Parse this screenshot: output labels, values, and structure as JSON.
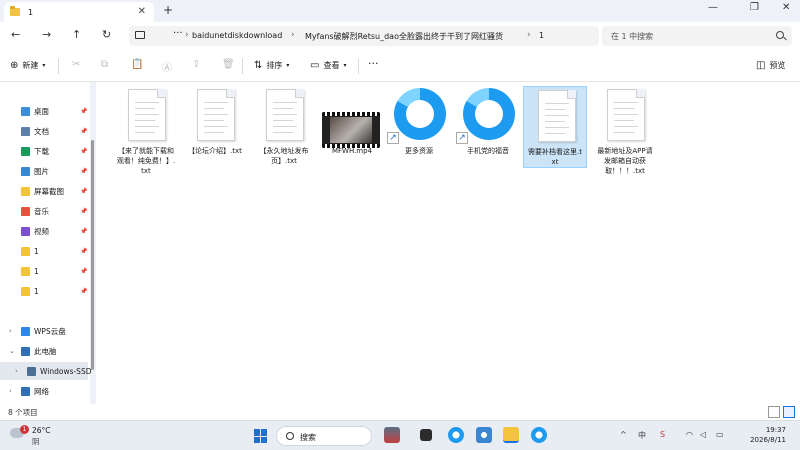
{
  "window": {
    "tab_title": "1",
    "tab_close": "✕",
    "new_tab": "+",
    "minimize": "—",
    "maximize": "❐",
    "close": "✕"
  },
  "nav": {
    "back": "←",
    "forward": "→",
    "up": "↑",
    "refresh": "↻",
    "more": "···",
    "breadcrumbs": [
      "baidunetdiskdownload",
      "Myfans破解烈Retsu_dao全脸露出终于干到了网红骚货",
      "1"
    ],
    "separator": "›",
    "search_placeholder": "在 1 中搜索"
  },
  "toolbar": {
    "new_label": "新建",
    "sort_label": "排序",
    "view_label": "查看",
    "more_label": "···",
    "preview_label": "预览"
  },
  "sidebar": {
    "quick": [
      {
        "label": "桌面",
        "icon": "desktop-icon",
        "color": "#3b8fd9"
      },
      {
        "label": "文档",
        "icon": "documents-icon",
        "color": "#5b7fa6"
      },
      {
        "label": "下载",
        "icon": "download-icon",
        "color": "#1a9b5e"
      },
      {
        "label": "图片",
        "icon": "pictures-icon",
        "color": "#3a86d0"
      },
      {
        "label": "屏幕截图",
        "icon": "folder-icon",
        "color": "#f3c33e"
      },
      {
        "label": "音乐",
        "icon": "music-icon",
        "color": "#e0553b"
      },
      {
        "label": "视频",
        "icon": "video-icon",
        "color": "#7b4fd0"
      },
      {
        "label": "1",
        "icon": "folder-icon",
        "color": "#f3c33e"
      },
      {
        "label": "1",
        "icon": "folder-icon",
        "color": "#f3c33e"
      },
      {
        "label": "1",
        "icon": "folder-icon",
        "color": "#f3c33e"
      }
    ],
    "tree": [
      {
        "label": "WPS云盘",
        "icon": "cloud-icon",
        "color": "#2f87e0"
      },
      {
        "label": "此电脑",
        "icon": "computer-icon",
        "color": "#2f6fb5"
      },
      {
        "label": "Windows-SSD",
        "icon": "drive-icon",
        "color": "#4a6f94"
      },
      {
        "label": "网络",
        "icon": "network-icon",
        "color": "#2f6fb5"
      }
    ]
  },
  "files": [
    {
      "name": "【来了就能下载和观看！纯免费！】.txt",
      "kind": "txt"
    },
    {
      "name": "【论坛介绍】.txt",
      "kind": "txt"
    },
    {
      "name": "【永久地址发布页】.txt",
      "kind": "txt"
    },
    {
      "name": "MFWH.mp4",
      "kind": "video"
    },
    {
      "name": "更多资源",
      "kind": "app"
    },
    {
      "name": "手机党的福音",
      "kind": "app"
    },
    {
      "name": "需要补档看这里.txt",
      "kind": "txt"
    },
    {
      "name": "最新地址及APP请发邮箱自动获取！！！.txt",
      "kind": "txt"
    }
  ],
  "status": {
    "item_count": "8 个项目"
  },
  "taskbar": {
    "weather_temp": "26°C",
    "weather_cond": "阴",
    "notification_count": "1",
    "search_label": "搜索",
    "time": "19:37",
    "date": "2026/8/11",
    "tray_chevron": "^",
    "ime": "中"
  }
}
